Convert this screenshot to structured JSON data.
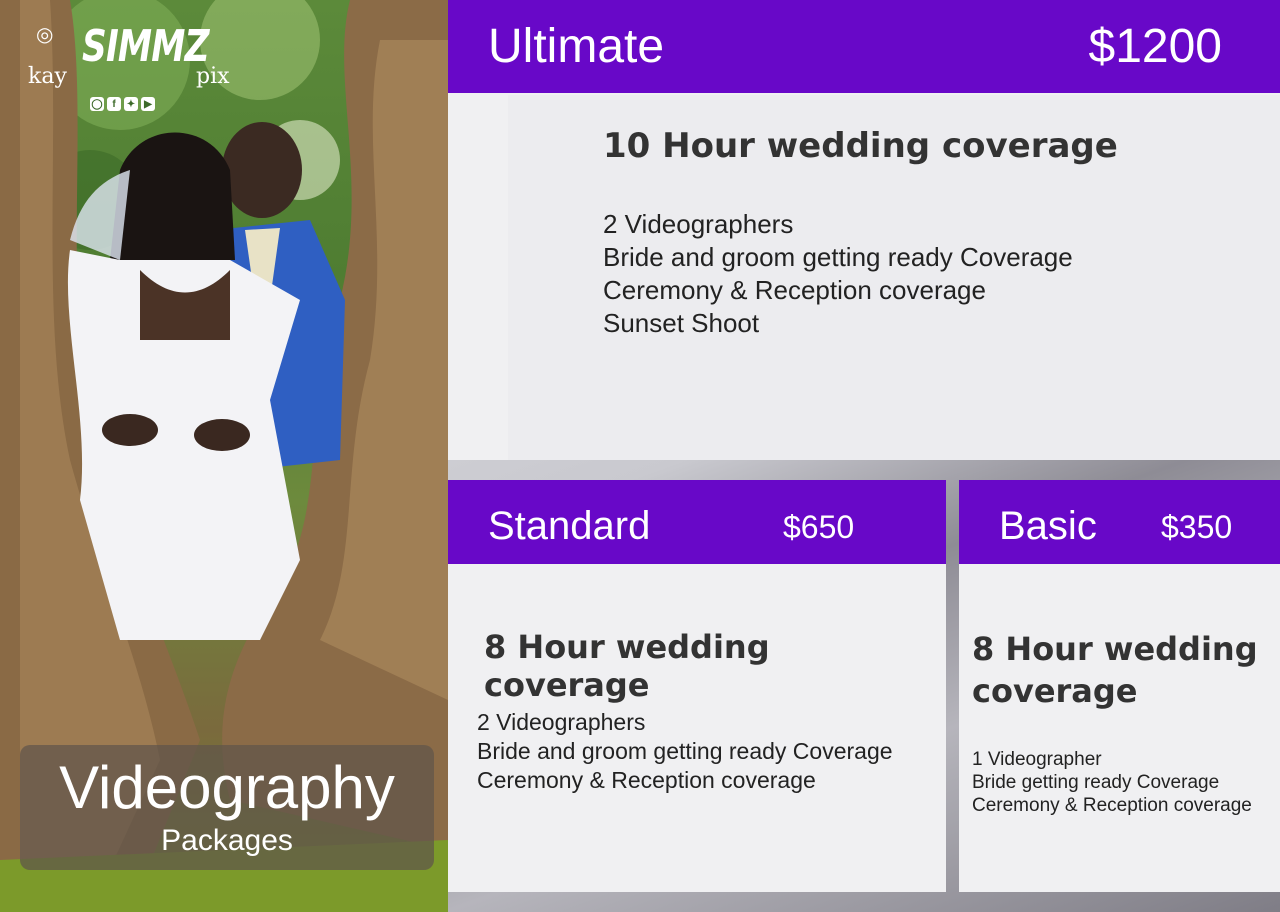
{
  "brand": {
    "top": "SIMMZ",
    "left": "kay",
    "right": "pix",
    "social_icons": [
      "instagram-icon",
      "facebook-icon",
      "twitter-icon",
      "youtube-icon"
    ]
  },
  "title": {
    "main": "Videography",
    "sub": "Packages"
  },
  "packages": {
    "ultimate": {
      "name": "Ultimate",
      "price": "$1200",
      "heading": "10 Hour wedding coverage",
      "items": [
        "2 Videographers",
        "Bride and groom getting ready Coverage",
        "Ceremony & Reception coverage",
        "Sunset Shoot"
      ]
    },
    "standard": {
      "name": "Standard",
      "price": "$650",
      "heading": "8 Hour wedding coverage",
      "items": [
        "2 Videographers",
        "Bride and groom getting ready Coverage",
        "Ceremony & Reception coverage"
      ]
    },
    "basic": {
      "name": "Basic",
      "price": "$350",
      "heading": "8 Hour wedding coverage",
      "items": [
        "1 Videographer",
        "Bride getting ready Coverage",
        "Ceremony & Reception coverage"
      ]
    }
  },
  "colors": {
    "header_purple": "#6808c8",
    "card_bg": "#f0f0f2",
    "text_dark": "#333333"
  }
}
